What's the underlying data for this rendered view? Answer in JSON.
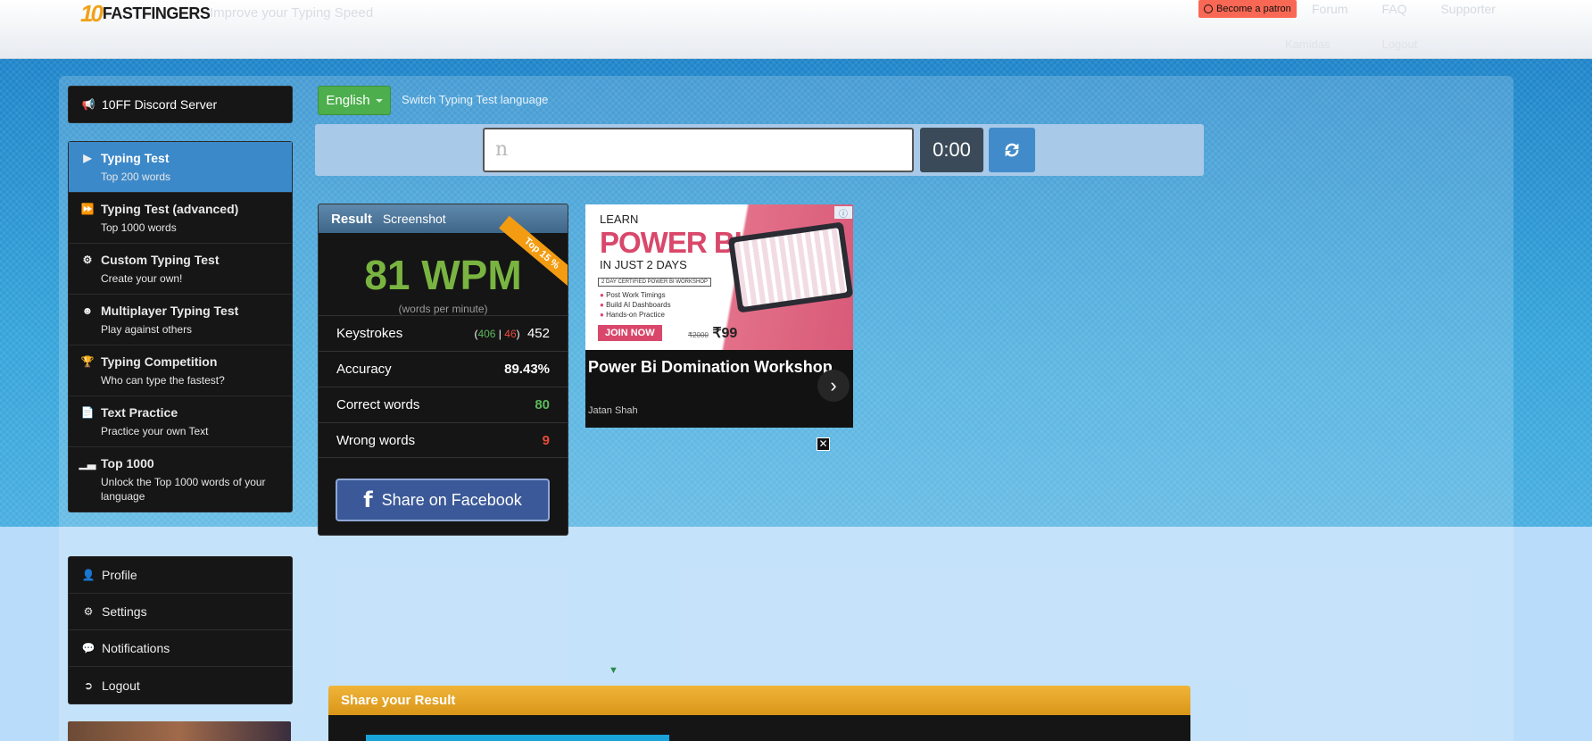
{
  "header": {
    "logo_prefix": "10",
    "logo_text": "FASTFINGERS",
    "tagline": "Improve your Typing Speed",
    "patron_label": "Become a patron",
    "top_links": [
      "Forum",
      "FAQ",
      "Supporter"
    ],
    "sub_links": [
      "Kamidas",
      "Logout"
    ]
  },
  "sidebar": {
    "discord": "10FF Discord Server",
    "nav": [
      {
        "title": "Typing Test",
        "sub": "Top 200 words",
        "icon": "play-icon"
      },
      {
        "title": "Typing Test (advanced)",
        "sub": "Top 1000 words",
        "icon": "fast-forward-icon"
      },
      {
        "title": "Custom Typing Test",
        "sub": "Create your own!",
        "icon": "gears-icon"
      },
      {
        "title": "Multiplayer Typing Test",
        "sub": "Play against others",
        "icon": "users-icon"
      },
      {
        "title": "Typing Competition",
        "sub": "Who can type the fastest?",
        "icon": "trophy-icon"
      },
      {
        "title": "Text Practice",
        "sub": "Practice your own Text",
        "icon": "document-icon"
      },
      {
        "title": "Top 1000",
        "sub": "Unlock the Top 1000 words of your language",
        "icon": "signal-icon"
      }
    ],
    "account": [
      {
        "label": "Profile",
        "icon": "user-icon"
      },
      {
        "label": "Settings",
        "icon": "gear-icon"
      },
      {
        "label": "Notifications",
        "icon": "comment-icon"
      },
      {
        "label": "Logout",
        "icon": "logout-icon"
      }
    ]
  },
  "test": {
    "language": "English",
    "switch_language": "Switch Typing Test language",
    "input_value": "n",
    "timer": "0:00"
  },
  "result": {
    "title": "Result",
    "screenshot": "Screenshot",
    "ribbon": "Top 15 %",
    "wpm": "81 WPM",
    "wpm_sub": "(words per minute)",
    "keystrokes_label": "Keystrokes",
    "keystrokes_correct": "406",
    "keystrokes_wrong": "46",
    "keystrokes_total": "452",
    "accuracy_label": "Accuracy",
    "accuracy_value": "89.43%",
    "correct_label": "Correct words",
    "correct_value": "80",
    "wrong_label": "Wrong words",
    "wrong_value": "9",
    "facebook_label": "Share on Facebook"
  },
  "ad": {
    "learn": "LEARN",
    "headline": "POWER BI",
    "days": "IN JUST 2 DAYS",
    "cert": "2 DAY CERTIFIED POWER BI WORKSHOP",
    "bullets": [
      "Post Work Timings",
      "Build AI Dashboards",
      "Hands-on Practice"
    ],
    "join": "JOIN NOW",
    "old_price": "₹2000",
    "price": "₹99",
    "title": "Power Bi Domination Workshop",
    "author": "Jatan Shah"
  },
  "share": {
    "title": "Share your Result"
  },
  "colors": {
    "accent_blue": "#428bca",
    "wpm_green": "#79b441",
    "share_orange": "#e8a52a",
    "facebook": "#3b5998"
  }
}
